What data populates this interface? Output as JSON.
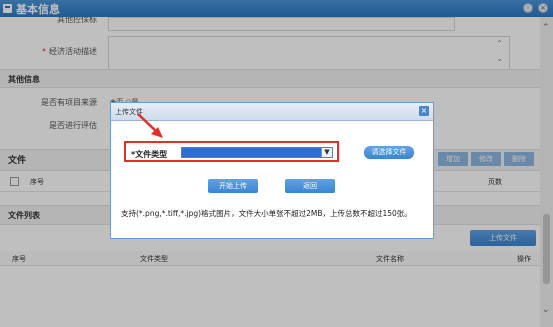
{
  "window": {
    "title": "基本信息"
  },
  "form": {
    "row0_label": "其他控保标",
    "econ_required_mark": "*",
    "econ_label": "经济活动描述",
    "other_section": "其他信息",
    "project_source_label": "是否有项目来源",
    "project_source_options": [
      "否",
      "是"
    ],
    "evaluate_label": "是否进行评估"
  },
  "files_section": {
    "title": "文件",
    "col_index": "序号",
    "col_pages": "页数",
    "buttons": {
      "add": "增加",
      "edit": "修改",
      "delete": "删除"
    }
  },
  "file_list": {
    "title": "文件列表",
    "upload_button": "上传文件",
    "columns": {
      "index": "序号",
      "type": "文件类型",
      "name": "文件名称",
      "action": "操作"
    }
  },
  "dialog": {
    "title": "上传文件",
    "file_type_label": "*文件类型",
    "file_type_value": "",
    "choose_file_button": "请选择文件",
    "start_upload_button": "开始上传",
    "return_button": "返回",
    "notice": "支持(*.png,*.tiff,*.jpg)格式图片，文件大小单张不超过2MB，上传总数不超过150张。"
  },
  "colors": {
    "accent": "#2d78c4",
    "highlight": "#e0302a"
  },
  "icons": {
    "close": "close-icon",
    "dropdown": "chevron-down-icon",
    "arrow": "pointer-arrow"
  }
}
